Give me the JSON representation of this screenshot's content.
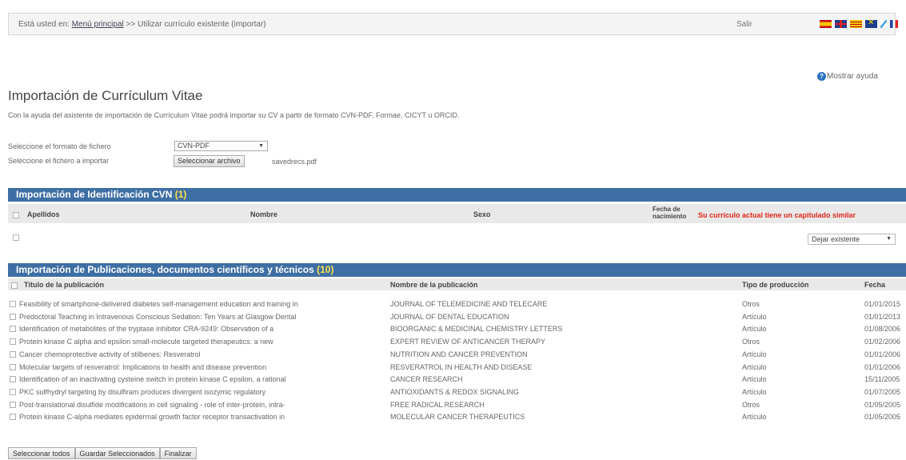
{
  "breadcrumb": {
    "prefix": "Está usted en:",
    "home_link": "Menú principal",
    "separator": ">>",
    "current": "Utilizar currículo existente (importar)"
  },
  "header": {
    "exit_label": "Salir"
  },
  "languages": [
    {
      "icon": "spain-flag-icon",
      "lang": "es"
    },
    {
      "icon": "uk-flag-icon",
      "lang": "en"
    },
    {
      "icon": "catalan-flag-icon",
      "lang": "ca"
    },
    {
      "icon": "basque-flag-icon",
      "lang": "eu"
    },
    {
      "icon": "galician-flag-icon",
      "lang": "gl"
    },
    {
      "icon": "france-flag-icon",
      "lang": "fr"
    }
  ],
  "help": {
    "label": "Mostrar ayuda",
    "icon": "help-icon"
  },
  "page": {
    "title": "Importación de Currículum Vitae",
    "intro": "Con la ayuda del asistente de importación de Currículum Vitae podrá importar su CV a partir de formato CVN-PDF, Formae, CICYT u ORCID."
  },
  "form": {
    "format_label": "Seleccione el formato de fichero",
    "format_value": "CVN-PDF",
    "file_label": "Seleccione el fichero a importar",
    "file_button": "Seleccionar archivo",
    "file_name": "savedrecs.pdf"
  },
  "identification": {
    "title": "Importación de Identificación CVN",
    "count": "(1)",
    "columns": [
      "Apellidos",
      "Nombre",
      "Sexo",
      "Fecha de nacimiento"
    ],
    "warning": "Su currículo actual tiene un capitulado similar",
    "action_value": "Dejar existente"
  },
  "publications": {
    "title": "Importación de Publicaciones, documentos científicos y técnicos",
    "count": "(10)",
    "columns": [
      "Título de la publicación",
      "Nombre de la publicación",
      "Tipo de producción",
      "Fecha"
    ],
    "rows": [
      {
        "title": "Feasibility of smartphone-delivered diabetes self-management education and training in",
        "journal": "JOURNAL OF TELEMEDICINE AND TELECARE",
        "type": "Otros",
        "date": "01/01/2015"
      },
      {
        "title": "Predoctoral Teaching in Intravenous Conscious Sedation: Ten Years at Glasgow Dental",
        "journal": "JOURNAL OF DENTAL EDUCATION",
        "type": "Artículo",
        "date": "01/01/2013"
      },
      {
        "title": "Identification of metabolites of the tryptase inhibitor CRA-9249: Observation of a",
        "journal": "BIOORGANIC & MEDICINAL CHEMISTRY LETTERS",
        "type": "Artículo",
        "date": "01/08/2006"
      },
      {
        "title": "Protein kinase C alpha and epsilon small-molecule targeted therapeutics: a new",
        "journal": "EXPERT REVIEW OF ANTICANCER THERAPY",
        "type": "Otros",
        "date": "01/02/2006"
      },
      {
        "title": "Cancer chemoprotective activity of stilbenes: Resveratrol",
        "journal": "NUTRITION AND CANCER PREVENTION",
        "type": "Artículo",
        "date": "01/01/2006"
      },
      {
        "title": "Molecular targets of resveratrol: Implications to health and disease prevention",
        "journal": "RESVERATROL IN HEALTH AND DISEASE",
        "type": "Artículo",
        "date": "01/01/2006"
      },
      {
        "title": "Identification of an inactivating cysteine switch in protein kinase C epsilon, a rational",
        "journal": "CANCER RESEARCH",
        "type": "Artículo",
        "date": "15/11/2005"
      },
      {
        "title": "PKC sulfhydryl targeting by disulfiram produces divergent isozymic regulatory",
        "journal": "ANTIOXIDANTS & REDOX SIGNALING",
        "type": "Artículo",
        "date": "01/07/2005"
      },
      {
        "title": "Post-translational disulfide modifications in cell signaling - role of inter-protein, intra-",
        "journal": "FREE RADICAL RESEARCH",
        "type": "Otros",
        "date": "01/05/2005"
      },
      {
        "title": "Protein kinase C-alpha mediates epidermal growth factor receptor transactivation in",
        "journal": "MOLECULAR CANCER THERAPEUTICS",
        "type": "Artículo",
        "date": "01/05/2005"
      }
    ]
  },
  "actions": {
    "select_all": "Seleccionar todos",
    "save_selected": "Guardar Seleccionados",
    "finish": "Finalizar"
  }
}
